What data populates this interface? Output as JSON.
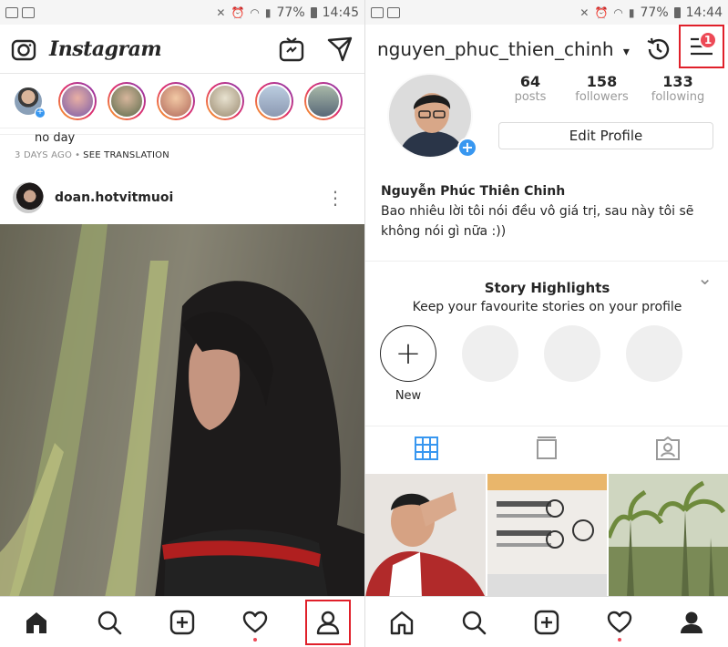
{
  "status": {
    "battery": "77%",
    "time": "14:45",
    "time_right": "14:44"
  },
  "left": {
    "header": {
      "logo": "Instagram"
    },
    "prev_caption": "no day",
    "prev_meta": "3 DAYS AGO",
    "prev_separator": "•",
    "translation": "SEE TRANSLATION",
    "post": {
      "username": "doan.hotvitmuoi",
      "more_glyph": "⋮"
    }
  },
  "right": {
    "header": {
      "username": "nguyen_phuc_thien_chinh",
      "dropdown_glyph": "▾",
      "badge": "1"
    },
    "stats": [
      {
        "value": "64",
        "label": "posts"
      },
      {
        "value": "158",
        "label": "followers"
      },
      {
        "value": "133",
        "label": "following"
      }
    ],
    "edit_profile": "Edit Profile",
    "full_name": "Nguyễn Phúc Thiên Chinh",
    "bio": "Bao nhiêu lời tôi nói đều vô giá trị, sau này tôi sẽ không nói gì nữa :))",
    "highlights": {
      "title": "Story Highlights",
      "subtitle": "Keep your favourite stories on your profile",
      "new_label": "New",
      "plus_glyph": "+",
      "collapse_glyph": "⌄"
    }
  },
  "colors": {
    "accent_blue": "#3897f0",
    "highlight_red": "#e0202a",
    "notification_red": "#ed4956"
  }
}
